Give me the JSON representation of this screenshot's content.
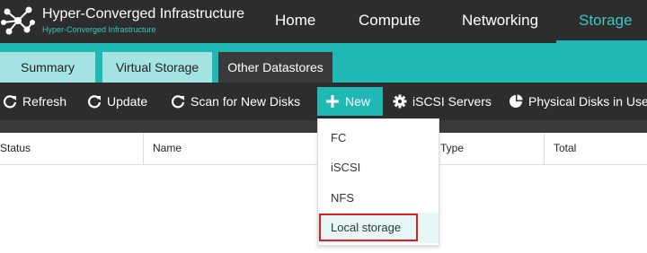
{
  "brand": {
    "title": "Hyper-Converged Infrastructure",
    "subtitle": "Hyper-Converged Infrastructure"
  },
  "nav": {
    "items": [
      "Home",
      "Compute",
      "Networking",
      "Storage"
    ],
    "active": "Storage"
  },
  "tabs": {
    "items": [
      "Summary",
      "Virtual Storage",
      "Other Datastores"
    ],
    "active": "Other Datastores"
  },
  "toolbar": {
    "refresh": "Refresh",
    "update": "Update",
    "scan": "Scan for New Disks",
    "new": "New",
    "iscsi_servers": "iSCSI Servers",
    "physical_disks": "Physical Disks in Use"
  },
  "table": {
    "columns": [
      "Status",
      "Name",
      "Type",
      "Total"
    ]
  },
  "new_menu": {
    "items": [
      "FC",
      "iSCSI",
      "NFS",
      "Local storage"
    ],
    "highlighted": "Local storage"
  },
  "colors": {
    "accent": "#1fb8b5",
    "dark": "#2d2d2d",
    "highlight": "#e01d1d"
  }
}
